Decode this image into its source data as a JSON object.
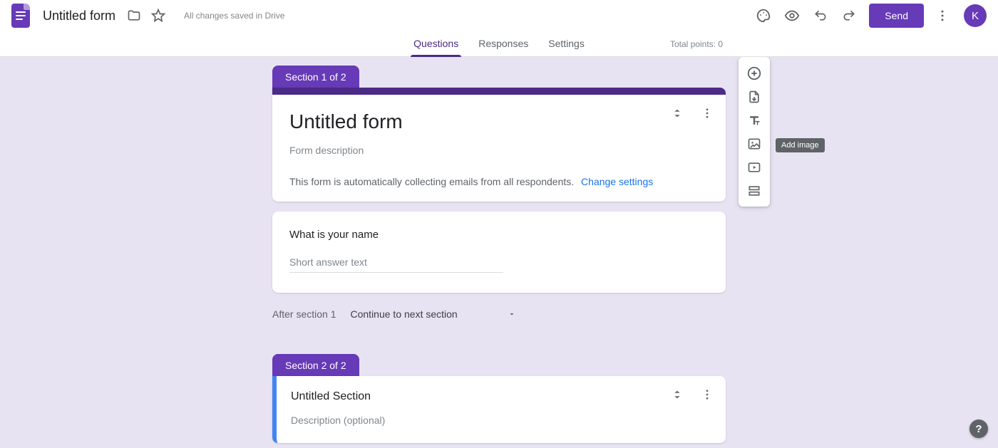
{
  "header": {
    "doc_title": "Untitled form",
    "save_status": "All changes saved in Drive",
    "send_label": "Send",
    "avatar_initial": "K"
  },
  "tabs": {
    "questions": "Questions",
    "responses": "Responses",
    "settings": "Settings",
    "total_points": "Total points: 0"
  },
  "toolbar": {
    "add_question": "Add question",
    "import_questions": "Import questions",
    "add_title": "Add title and description",
    "add_image": "Add image",
    "add_video": "Add video",
    "add_section": "Add section"
  },
  "tooltip_visible": "Add image",
  "section1": {
    "badge": "Section 1 of 2",
    "title": "Untitled form",
    "description_placeholder": "Form description",
    "email_notice": "This form is automatically collecting emails from all respondents.",
    "change_settings": "Change settings",
    "question1": {
      "text": "What is your name",
      "answer_placeholder": "Short answer text"
    },
    "after_label": "After section 1",
    "after_value": "Continue to next section"
  },
  "section2": {
    "badge": "Section 2 of 2",
    "title": "Untitled Section",
    "description_placeholder": "Description (optional)"
  }
}
